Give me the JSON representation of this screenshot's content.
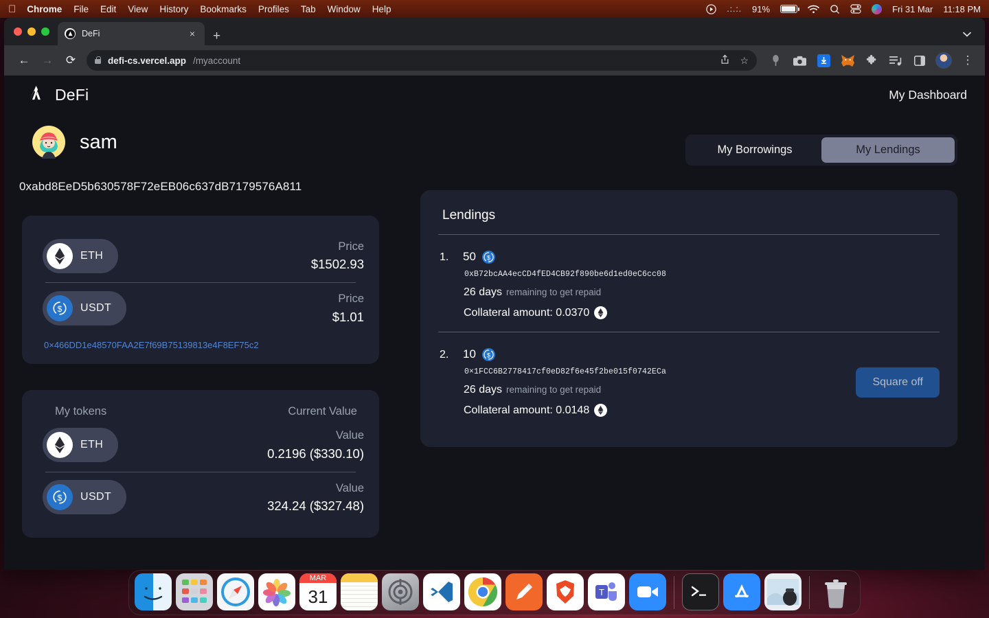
{
  "menubar": {
    "apple": "",
    "items": [
      {
        "label": "Chrome",
        "bold": true
      },
      {
        "label": "File",
        "bold": false
      },
      {
        "label": "Edit",
        "bold": false
      },
      {
        "label": "View",
        "bold": false
      },
      {
        "label": "History",
        "bold": false
      },
      {
        "label": "Bookmarks",
        "bold": false
      },
      {
        "label": "Profiles",
        "bold": false
      },
      {
        "label": "Tab",
        "bold": false
      },
      {
        "label": "Window",
        "bold": false
      },
      {
        "label": "Help",
        "bold": false
      }
    ],
    "battery_percent": "91%",
    "date": "Fri 31 Mar",
    "time": "11:18 PM"
  },
  "browser": {
    "tab_title": "DeFi",
    "tab_close": "×",
    "new_tab": "+",
    "tabstrip_chevron": "▼",
    "back": "←",
    "forward": "→",
    "reload": "⟳",
    "url_host": "defi-cs.vercel.app",
    "url_path": "/myaccount",
    "share": "⇧",
    "bookmark_star": "☆",
    "download_glyph": "↓",
    "fox_glyph": "🦊",
    "puzzle_glyph": "✦",
    "reading_list": "≣",
    "side_panel": "▣",
    "menu_dots": "⋮",
    "bug_glyph": "☸",
    "camera_glyph": "■"
  },
  "site": {
    "brand_name": "DeFi",
    "dashboard_link": "My Dashboard",
    "user_name": "sam",
    "wallet_address": "0xabd8EeD5b630578F72eEB06c637dB7179576A811"
  },
  "tabs": {
    "borrowings_label": "My Borrowings",
    "lendings_label": "My Lendings",
    "active": "lendings"
  },
  "prices_card": {
    "rows": [
      {
        "symbol": "ETH",
        "value_label": "Price",
        "value_amount": "$1502.93",
        "coin": "eth"
      },
      {
        "symbol": "USDT",
        "value_label": "Price",
        "value_amount": "$1.01",
        "coin": "usdt"
      }
    ],
    "contract_link": "0×466DD1e48570FAA2E7f69B75139813e4F8EF75c2"
  },
  "tokens_card": {
    "title": "My tokens",
    "value_header": "Current Value",
    "rows": [
      {
        "symbol": "ETH",
        "value_label": "Value",
        "value_amount": "0.2196 ($330.10)",
        "coin": "eth"
      },
      {
        "symbol": "USDT",
        "value_label": "Value",
        "value_amount": "324.24 ($327.48)",
        "coin": "usdt"
      }
    ]
  },
  "lendings": {
    "title": "Lendings",
    "items": [
      {
        "index": "1.",
        "amount": "50",
        "address": "0xB72bcAA4ecCD4fED4CB92f890be6d1ed0eC6cc08",
        "days": "26 days",
        "days_suffix": "remaining to get repaid",
        "collateral": "Collateral amount: 0.0370",
        "has_button": false,
        "button_label": ""
      },
      {
        "index": "2.",
        "amount": "10",
        "address": "0×1FCC6B2778417cf0eD82f6e45f2be015f0742ECa",
        "days": "26 days",
        "days_suffix": "remaining to get repaid",
        "collateral": "Collateral amount: 0.0148",
        "has_button": true,
        "button_label": "Square off"
      }
    ]
  },
  "dock": {
    "apps": [
      {
        "name": "finder",
        "running": true
      },
      {
        "name": "launchpad",
        "running": false
      },
      {
        "name": "safari",
        "running": false
      },
      {
        "name": "photos",
        "running": false
      },
      {
        "name": "calendar",
        "running": false,
        "month": "MAR",
        "day": "31"
      },
      {
        "name": "notes",
        "running": false
      },
      {
        "name": "system-settings",
        "running": false
      },
      {
        "name": "vscode",
        "running": false
      },
      {
        "name": "chrome",
        "running": true
      },
      {
        "name": "postman",
        "running": false
      },
      {
        "name": "brave",
        "running": false
      },
      {
        "name": "teams",
        "running": false
      },
      {
        "name": "zoom",
        "running": false
      },
      {
        "name": "terminal",
        "running": false
      },
      {
        "name": "app-store",
        "running": false
      },
      {
        "name": "preview",
        "running": false
      },
      {
        "name": "trash",
        "running": false
      }
    ]
  },
  "colors": {
    "page_bg": "#111318",
    "card_bg": "#1e2230",
    "accent_blue": "#20508f",
    "link_blue": "#4f86d6",
    "usdt_blue": "#2775ca",
    "seg_active": "#7c8097"
  }
}
